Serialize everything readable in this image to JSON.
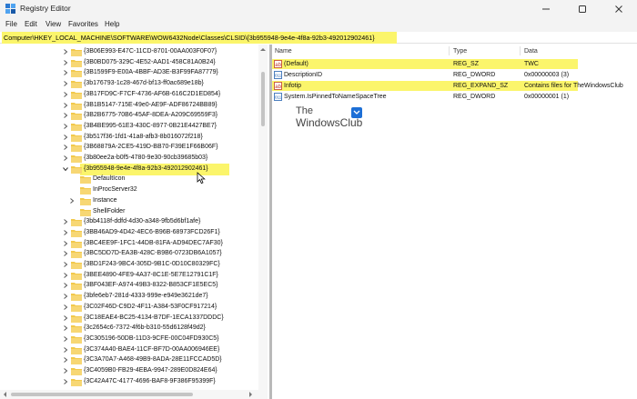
{
  "window": {
    "title": "Registry Editor"
  },
  "menu": [
    "File",
    "Edit",
    "View",
    "Favorites",
    "Help"
  ],
  "address": {
    "path": "Computer\\HKEY_LOCAL_MACHINE\\SOFTWARE\\WOW6432Node\\Classes\\CLSID\\{3b955948-9e4e-4f8a-92b3-492012902461}"
  },
  "tree": [
    {
      "label": "{3B06E993-E47C-11CD-8701-00AA003F0F07}",
      "expanded": false
    },
    {
      "label": "{3B0BD075-329C-4E52-AAD1-458C81A0B24}",
      "expanded": false
    },
    {
      "label": "{3B1599F9-E00A-4BBF-AD3E-B3F99FA87779}",
      "expanded": false
    },
    {
      "label": "{3b176793-1c28-467d-bf13-ff0ac689e18b}",
      "expanded": false
    },
    {
      "label": "{3B17FD9C-F7CF-4736-AF6B-616C2D1ED854}",
      "expanded": false
    },
    {
      "label": "{3B1B5147-715E-49e0-AE9F-ADF86724BB89}",
      "expanded": false
    },
    {
      "label": "{3B2B6775-70B6-45AF-8DEA-A209C69559F3}",
      "expanded": false
    },
    {
      "label": "{3B4BE995-61E3-430C-8977-0B21E4427BE7}",
      "expanded": false
    },
    {
      "label": "{3b517f36-1fd1-41a8-afb3-8b016072f218}",
      "expanded": false
    },
    {
      "label": "{3B68879A-2CE5-419D-BB70-F39E1F66B06F}",
      "expanded": false
    },
    {
      "label": "{3b80ee2a-b0f5-4780-9e30-90cb39685b03}",
      "expanded": false
    },
    {
      "label": "{3b955948-9e4e-4f8a-92b3-492012902461}",
      "expanded": true,
      "selected": true
    },
    {
      "label": "DefaultIcon",
      "child": true
    },
    {
      "label": "InProcServer32",
      "child": true
    },
    {
      "label": "Instance",
      "child": true,
      "hasChildren": true
    },
    {
      "label": "ShellFolder",
      "child": true
    },
    {
      "label": "{3bb4118f-ddfd-4d30-a348-9fb5d6bf1afe}",
      "expanded": false
    },
    {
      "label": "{3BB46AD9-4D42-4EC6-B96B-68973FCD26F1}",
      "expanded": false
    },
    {
      "label": "{3BC4EE9F-1FC1-44DB-81FA-AD94DEC7AF30}",
      "expanded": false
    },
    {
      "label": "{3BC5DD7D-EA3B-428C-B9B6-0723DB6A1057}",
      "expanded": false
    },
    {
      "label": "{3BD1F243-9BC4-305D-9B1C-0D10C80329FC}",
      "expanded": false
    },
    {
      "label": "{3BEE4890-4FE9-4A37-8C1E-5E7E12791C1F}",
      "expanded": false
    },
    {
      "label": "{3BF043EF-A974-49B3-8322-B853CF1E5EC5}",
      "expanded": false
    },
    {
      "label": "{3bfe6eb7-281d-4333-999e-e949e3621de7}",
      "expanded": false
    },
    {
      "label": "{3C02F46D-C9D2-4F11-A384-53F0CF917214}",
      "expanded": false
    },
    {
      "label": "{3C18EAE4-BC25-4134-B7DF-1ECA1337DDDC}",
      "expanded": false
    },
    {
      "label": "{3c2654c6-7372-4f6b-b310-55d6128f49d2}",
      "expanded": false
    },
    {
      "label": "{3C305196-50DB-11D3-9CFE-00C04FD930C5}",
      "expanded": false
    },
    {
      "label": "{3C374A40-BAE4-11CF-BF7D-00AA006946EE}",
      "expanded": false
    },
    {
      "label": "{3C3A70A7-A468-49B9-8ADA-28E11FCCAD5D}",
      "expanded": false
    },
    {
      "label": "{3C4059B0-FB29-4EBA-9947-289E0D824E64}",
      "expanded": false
    },
    {
      "label": "{3C42A47C-4177-4696-BAF8-9F386F95399F}",
      "expanded": false
    }
  ],
  "list": {
    "headers": {
      "name": "Name",
      "type": "Type",
      "data": "Data"
    },
    "rows": [
      {
        "name": "(Default)",
        "type": "REG_SZ",
        "data": "TWC",
        "icon": "string-value-icon",
        "highlight": true
      },
      {
        "name": "DescriptionID",
        "type": "REG_DWORD",
        "data": "0x00000003 (3)",
        "icon": "dword-value-icon",
        "highlight": false
      },
      {
        "name": "Infotip",
        "type": "REG_EXPAND_SZ",
        "data": "Contains files for TheWindowsClub",
        "icon": "string-value-icon",
        "highlight": true
      },
      {
        "name": "System.IsPinnedToNameSpaceTree",
        "type": "REG_DWORD",
        "data": "0x00000001 (1)",
        "icon": "dword-value-icon",
        "highlight": false
      }
    ]
  },
  "watermark": {
    "line1": "The",
    "line2": "WindowsClub"
  },
  "colors": {
    "highlight": "#fbf56b",
    "folder": "#f2c94c",
    "accent": "#1d6fd6"
  }
}
